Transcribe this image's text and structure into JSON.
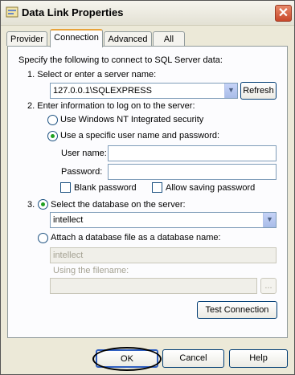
{
  "window": {
    "title": "Data Link Properties",
    "close_label": "✕"
  },
  "tabs": [
    {
      "label": "Provider"
    },
    {
      "label": "Connection"
    },
    {
      "label": "Advanced"
    },
    {
      "label": "All"
    }
  ],
  "connection": {
    "intro": "Specify the following to connect to SQL Server data:",
    "step1_label": "1. Select or enter a server name:",
    "server_value": "127.0.0.1\\SQLEXPRESS",
    "refresh_label": "Refresh",
    "step2_label": "2. Enter information to log on to the server:",
    "windows_nt_label": "Use Windows NT Integrated security",
    "specific_user_label": "Use a specific user name and password:",
    "username_label": "User name:",
    "username_value": "",
    "password_label": "Password:",
    "password_value": "",
    "blank_password_label": "Blank password",
    "allow_saving_label": "Allow saving password",
    "step3_number": "3.",
    "select_db_label": "Select the database on the server:",
    "database_value": "intellect",
    "attach_label": "Attach a database file as a database name:",
    "attach_name_value": "intellect",
    "filename_label": "Using the filename:",
    "filename_value": "",
    "browse_label": "...",
    "test_label": "Test Connection"
  },
  "footer": {
    "ok_label": "OK",
    "cancel_label": "Cancel",
    "help_label": "Help"
  }
}
